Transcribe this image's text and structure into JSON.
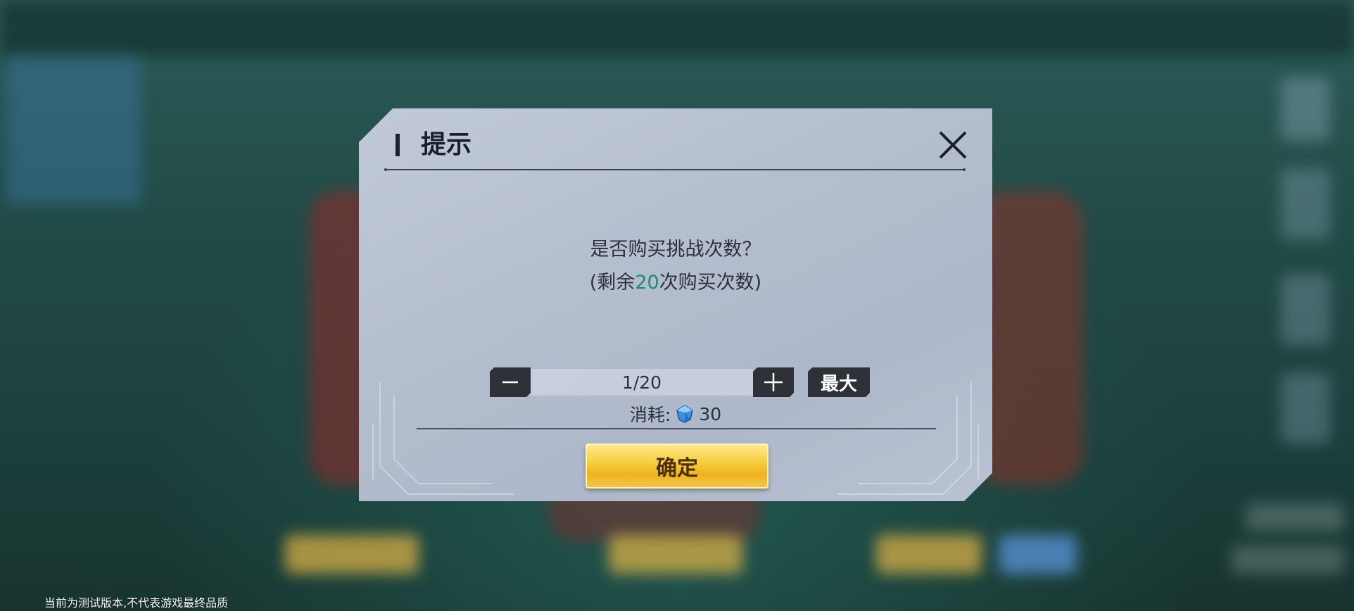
{
  "dialog": {
    "title": "提示",
    "message_line1": "是否购买挑战次数？",
    "message_prefix": "(剩余",
    "remaining_count": "20",
    "message_suffix": "次购买次数)",
    "quantity_display": "1/20",
    "max_label": "最大",
    "cost_label": "消耗:",
    "cost_value": "30",
    "confirm_label": "确定"
  },
  "icons": {
    "close": "close-icon",
    "minus": "minus-icon",
    "plus": "plus-icon",
    "currency": "diamond-gem-icon"
  },
  "colors": {
    "highlight": "#1a8b78",
    "confirm_gold": "#f8cf44"
  },
  "footer": {
    "notice": "当前为测试版本,不代表游戏最终品质"
  }
}
